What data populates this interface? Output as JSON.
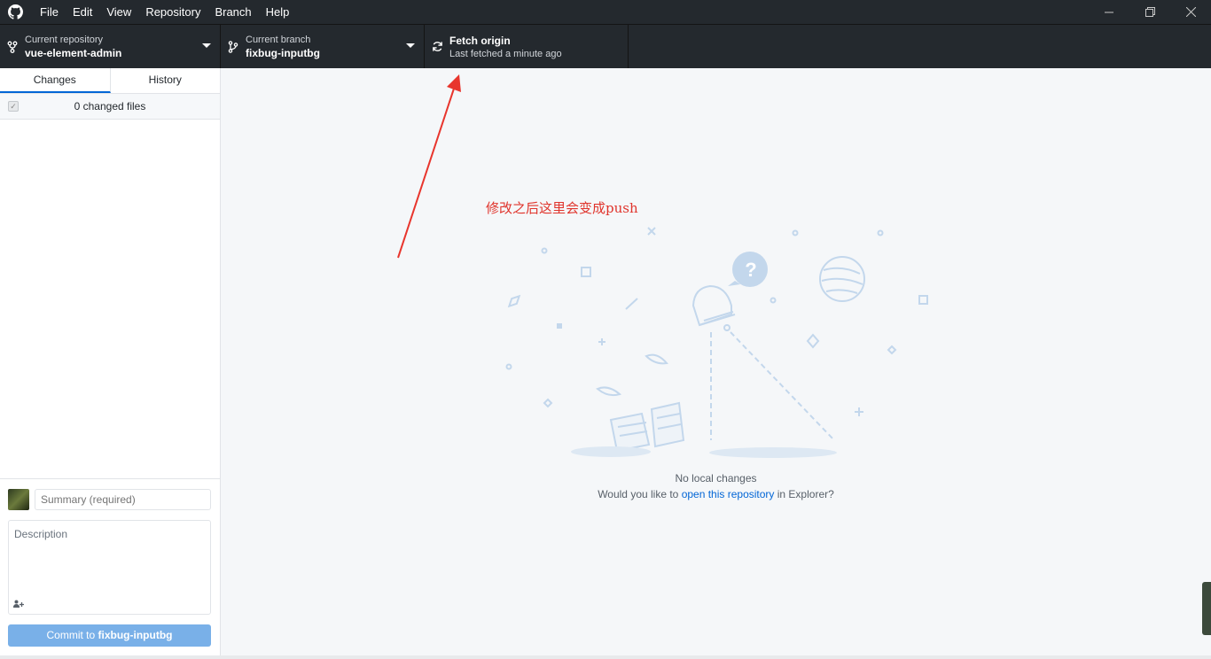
{
  "menu": [
    "File",
    "Edit",
    "View",
    "Repository",
    "Branch",
    "Help"
  ],
  "toolbar": {
    "repo_label": "Current repository",
    "repo_value": "vue-element-admin",
    "branch_label": "Current branch",
    "branch_value": "fixbug-inputbg",
    "fetch_label": "Fetch origin",
    "fetch_sub": "Last fetched a minute ago"
  },
  "tabs": {
    "changes": "Changes",
    "history": "History"
  },
  "changes": {
    "count_label": "0 changed files"
  },
  "commit": {
    "summary_placeholder": "Summary (required)",
    "description_placeholder": "Description",
    "button_prefix": "Commit to ",
    "button_branch": "fixbug-inputbg"
  },
  "blank": {
    "title": "No local changes",
    "sub_prefix": "Would you like to ",
    "sub_link": "open this repository",
    "sub_suffix": " in Explorer?"
  },
  "annotation": "修改之后这里会变成push",
  "colors": {
    "titlebar": "#24292e",
    "accent": "#0366d6",
    "commit_button": "#79b0e8",
    "annotation": "#e0342c"
  }
}
